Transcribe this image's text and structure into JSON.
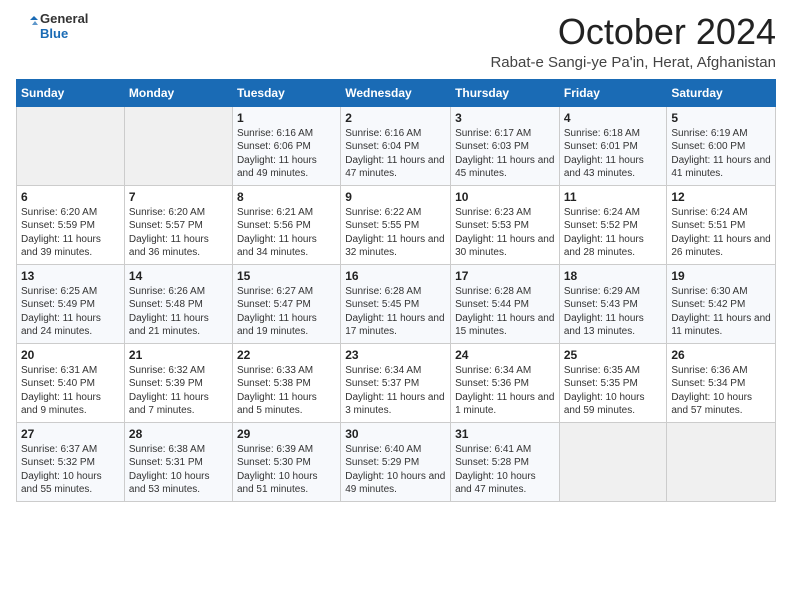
{
  "header": {
    "title": "October 2024",
    "subtitle": "Rabat-e Sangi-ye Pa'in, Herat, Afghanistan"
  },
  "days": [
    "Sunday",
    "Monday",
    "Tuesday",
    "Wednesday",
    "Thursday",
    "Friday",
    "Saturday"
  ],
  "weeks": [
    [
      {
        "day": "",
        "content": ""
      },
      {
        "day": "",
        "content": ""
      },
      {
        "day": "1",
        "content": "Sunrise: 6:16 AM\nSunset: 6:06 PM\nDaylight: 11 hours and 49 minutes."
      },
      {
        "day": "2",
        "content": "Sunrise: 6:16 AM\nSunset: 6:04 PM\nDaylight: 11 hours and 47 minutes."
      },
      {
        "day": "3",
        "content": "Sunrise: 6:17 AM\nSunset: 6:03 PM\nDaylight: 11 hours and 45 minutes."
      },
      {
        "day": "4",
        "content": "Sunrise: 6:18 AM\nSunset: 6:01 PM\nDaylight: 11 hours and 43 minutes."
      },
      {
        "day": "5",
        "content": "Sunrise: 6:19 AM\nSunset: 6:00 PM\nDaylight: 11 hours and 41 minutes."
      }
    ],
    [
      {
        "day": "6",
        "content": "Sunrise: 6:20 AM\nSunset: 5:59 PM\nDaylight: 11 hours and 39 minutes."
      },
      {
        "day": "7",
        "content": "Sunrise: 6:20 AM\nSunset: 5:57 PM\nDaylight: 11 hours and 36 minutes."
      },
      {
        "day": "8",
        "content": "Sunrise: 6:21 AM\nSunset: 5:56 PM\nDaylight: 11 hours and 34 minutes."
      },
      {
        "day": "9",
        "content": "Sunrise: 6:22 AM\nSunset: 5:55 PM\nDaylight: 11 hours and 32 minutes."
      },
      {
        "day": "10",
        "content": "Sunrise: 6:23 AM\nSunset: 5:53 PM\nDaylight: 11 hours and 30 minutes."
      },
      {
        "day": "11",
        "content": "Sunrise: 6:24 AM\nSunset: 5:52 PM\nDaylight: 11 hours and 28 minutes."
      },
      {
        "day": "12",
        "content": "Sunrise: 6:24 AM\nSunset: 5:51 PM\nDaylight: 11 hours and 26 minutes."
      }
    ],
    [
      {
        "day": "13",
        "content": "Sunrise: 6:25 AM\nSunset: 5:49 PM\nDaylight: 11 hours and 24 minutes."
      },
      {
        "day": "14",
        "content": "Sunrise: 6:26 AM\nSunset: 5:48 PM\nDaylight: 11 hours and 21 minutes."
      },
      {
        "day": "15",
        "content": "Sunrise: 6:27 AM\nSunset: 5:47 PM\nDaylight: 11 hours and 19 minutes."
      },
      {
        "day": "16",
        "content": "Sunrise: 6:28 AM\nSunset: 5:45 PM\nDaylight: 11 hours and 17 minutes."
      },
      {
        "day": "17",
        "content": "Sunrise: 6:28 AM\nSunset: 5:44 PM\nDaylight: 11 hours and 15 minutes."
      },
      {
        "day": "18",
        "content": "Sunrise: 6:29 AM\nSunset: 5:43 PM\nDaylight: 11 hours and 13 minutes."
      },
      {
        "day": "19",
        "content": "Sunrise: 6:30 AM\nSunset: 5:42 PM\nDaylight: 11 hours and 11 minutes."
      }
    ],
    [
      {
        "day": "20",
        "content": "Sunrise: 6:31 AM\nSunset: 5:40 PM\nDaylight: 11 hours and 9 minutes."
      },
      {
        "day": "21",
        "content": "Sunrise: 6:32 AM\nSunset: 5:39 PM\nDaylight: 11 hours and 7 minutes."
      },
      {
        "day": "22",
        "content": "Sunrise: 6:33 AM\nSunset: 5:38 PM\nDaylight: 11 hours and 5 minutes."
      },
      {
        "day": "23",
        "content": "Sunrise: 6:34 AM\nSunset: 5:37 PM\nDaylight: 11 hours and 3 minutes."
      },
      {
        "day": "24",
        "content": "Sunrise: 6:34 AM\nSunset: 5:36 PM\nDaylight: 11 hours and 1 minute."
      },
      {
        "day": "25",
        "content": "Sunrise: 6:35 AM\nSunset: 5:35 PM\nDaylight: 10 hours and 59 minutes."
      },
      {
        "day": "26",
        "content": "Sunrise: 6:36 AM\nSunset: 5:34 PM\nDaylight: 10 hours and 57 minutes."
      }
    ],
    [
      {
        "day": "27",
        "content": "Sunrise: 6:37 AM\nSunset: 5:32 PM\nDaylight: 10 hours and 55 minutes."
      },
      {
        "day": "28",
        "content": "Sunrise: 6:38 AM\nSunset: 5:31 PM\nDaylight: 10 hours and 53 minutes."
      },
      {
        "day": "29",
        "content": "Sunrise: 6:39 AM\nSunset: 5:30 PM\nDaylight: 10 hours and 51 minutes."
      },
      {
        "day": "30",
        "content": "Sunrise: 6:40 AM\nSunset: 5:29 PM\nDaylight: 10 hours and 49 minutes."
      },
      {
        "day": "31",
        "content": "Sunrise: 6:41 AM\nSunset: 5:28 PM\nDaylight: 10 hours and 47 minutes."
      },
      {
        "day": "",
        "content": ""
      },
      {
        "day": "",
        "content": ""
      }
    ]
  ]
}
